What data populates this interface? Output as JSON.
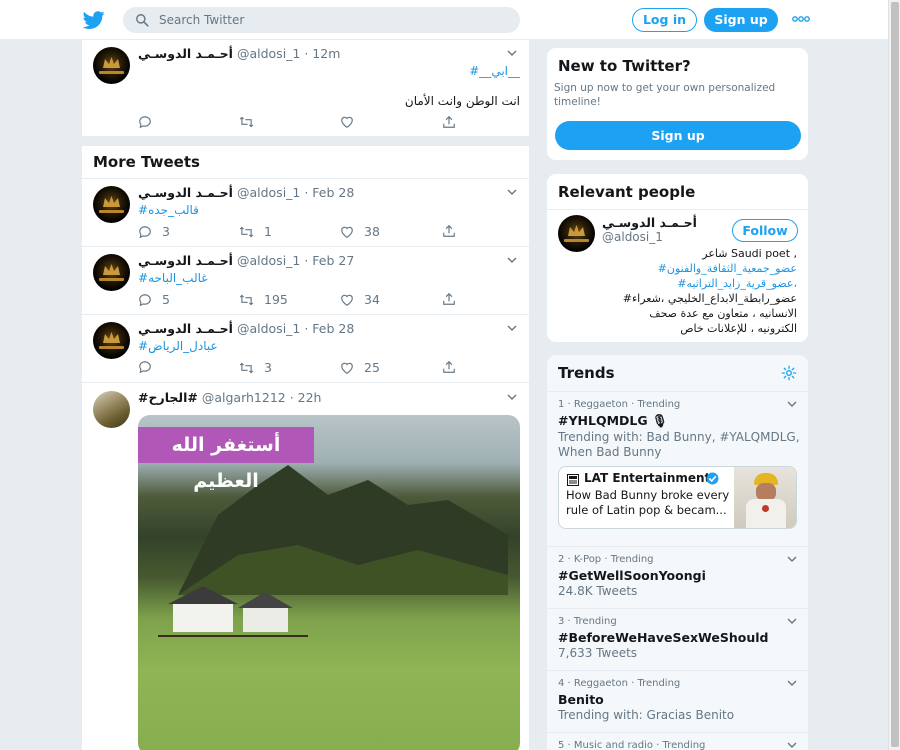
{
  "header": {
    "search_placeholder": "Search Twitter",
    "login_label": "Log in",
    "signup_label": "Sign up"
  },
  "thread_tweet": {
    "name": "أحـمـد الدوسـي",
    "meta": "@aldosi_1 · 12m",
    "hashtag": "#__ابي__",
    "text": "انت الوطن وانت الأمان"
  },
  "more_tweets": {
    "title": "More Tweets",
    "tweets": [
      {
        "name": "أحـمـد الدوسـي",
        "meta": "@aldosi_1 · Feb 28",
        "text": "#قالب_جده",
        "replies": "3",
        "retweets": "1",
        "likes": "38"
      },
      {
        "name": "أحـمـد الدوسـي",
        "meta": "@aldosi_1 · Feb 27",
        "text": "#غالب_الباحه",
        "replies": "5",
        "retweets": "195",
        "likes": "34"
      },
      {
        "name": "أحـمـد الدوسـي",
        "meta": "@aldosi_1 · Feb 28",
        "text": "#عبادل_الرياض",
        "replies": "",
        "retweets": "3",
        "likes": "25"
      }
    ],
    "video_tweet": {
      "name": "#الجارح#",
      "meta": "@algarh1212 · 22h",
      "overlay_text": "أستغفر الله العظيم"
    }
  },
  "new_to_twitter": {
    "title": "New to Twitter?",
    "desc_line1": "Sign up now to get your own personalized",
    "desc_line2": "timeline!",
    "button": "Sign up"
  },
  "relevant_people": {
    "title": "Relevant people",
    "name": "أحـمـد الدوسـي",
    "handle": "@aldosi_1",
    "follow": "Follow",
    "bio_line1": "شاعر Saudi poet ,",
    "bio_line2": "#عضو_جمعية_الثقافة_والفنون",
    "bio_line3": "#عضو_قرية_زايد_التراثيه،",
    "bio_line4": "#عضو_رابطة_الابداع_الخليجي ،شعراء",
    "bio_line5": "الانسانيه ، متعاون مع عدة صحف",
    "bio_line6": "الكترونيه ، للإعلانات خاص"
  },
  "trends": {
    "title": "Trends",
    "items": [
      {
        "meta": "1 · Reggaeton · Trending",
        "name": "#YHLQMDLG 🎙",
        "sub1": "Trending with: Bad Bunny, #YALQMDLG,",
        "sub2": "When Bad Bunny"
      },
      {
        "meta": "2 · K-Pop · Trending",
        "name": "#GetWellSoonYoongi",
        "sub1": "24.8K Tweets"
      },
      {
        "meta": "3 · Trending",
        "name": "#BeforeWeHaveSexWeShould",
        "sub1": "7,633 Tweets"
      },
      {
        "meta": "4 · Reggaeton · Trending",
        "name": "Benito",
        "sub1": "Trending with: Gracias Benito"
      },
      {
        "meta": "5 · Music and radio · Trending"
      }
    ],
    "news_card": {
      "source": "LAT Entertainment",
      "line1": "How Bad Bunny broke every",
      "line2": "rule of Latin pop & becam..."
    }
  },
  "colors": {
    "accent": "#1da1f2",
    "link": "#1b95e0",
    "muted": "#657786",
    "background": "#e6ecf0"
  },
  "icons": [
    "twitter-bird-icon",
    "search-icon",
    "more-dots-icon",
    "chevron-down-icon",
    "reply-icon",
    "retweet-icon",
    "like-icon",
    "share-icon",
    "verified-icon",
    "gear-icon"
  ]
}
